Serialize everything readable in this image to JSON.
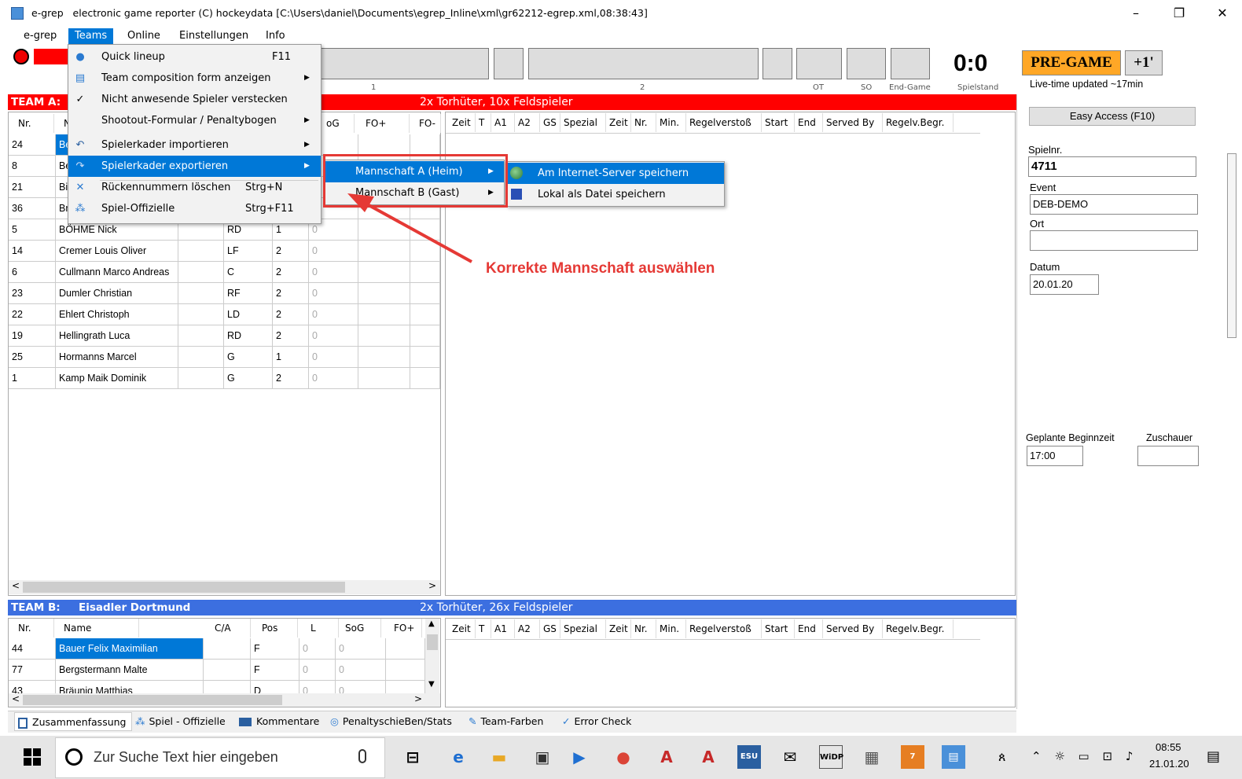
{
  "window": {
    "app_short": "e-grep",
    "title": "electronic game reporter (C) hockeydata [C:\\Users\\daniel\\Documents\\egrep_Inline\\xml\\gr62212-egrep.xml,08:38:43]",
    "minimize": "–",
    "maximize": "❐",
    "close": "✕"
  },
  "menubar": [
    "e-grep",
    "Teams",
    "Online",
    "Einstellungen",
    "Info"
  ],
  "scoreboard": {
    "score": "0:0",
    "labels": [
      "1",
      "2",
      "OT",
      "SO",
      "End-Game",
      "Spielstand"
    ],
    "status": "PRE-GAME",
    "plus": "+1'",
    "live_note": "Live-time updated ~17min"
  },
  "team_a": {
    "label": "TEAM A:",
    "summary": "2x Torhüter, 10x Feldspieler",
    "columns": [
      "Nr.",
      "N",
      "oG",
      "FO+",
      "FO-"
    ],
    "rows": [
      {
        "nr": "24",
        "name": "Be",
        "pos": "",
        "l": "",
        "sog": ""
      },
      {
        "nr": "8",
        "name": "Be",
        "pos": "",
        "l": "",
        "sog": ""
      },
      {
        "nr": "21",
        "name": "Bi",
        "pos": "",
        "l": "",
        "sog": ""
      },
      {
        "nr": "36",
        "name": "Br",
        "pos": "",
        "l": "",
        "sog": ""
      },
      {
        "nr": "5",
        "name": "BÖHME Nick",
        "pos": "RD",
        "l": "1",
        "sog": "0"
      },
      {
        "nr": "14",
        "name": "Cremer Louis Oliver",
        "pos": "LF",
        "l": "2",
        "sog": "0"
      },
      {
        "nr": "6",
        "name": "Cullmann Marco Andreas",
        "pos": "C",
        "l": "2",
        "sog": "0"
      },
      {
        "nr": "23",
        "name": "Dumler Christian",
        "pos": "RF",
        "l": "2",
        "sog": "0"
      },
      {
        "nr": "22",
        "name": "Ehlert Christoph",
        "pos": "LD",
        "l": "2",
        "sog": "0"
      },
      {
        "nr": "19",
        "name": "Hellingrath Luca",
        "pos": "RD",
        "l": "2",
        "sog": "0"
      },
      {
        "nr": "25",
        "name": "Hormanns Marcel",
        "pos": "G",
        "l": "1",
        "sog": "0"
      },
      {
        "nr": "1",
        "name": "Kamp Maik Dominik",
        "pos": "G",
        "l": "2",
        "sog": "0"
      }
    ]
  },
  "penalty_columns": [
    "Zeit",
    "T",
    "A1",
    "A2",
    "GS",
    "Spezial",
    "Zeit",
    "Nr.",
    "Min.",
    "Regelverstoß",
    "Start",
    "End",
    "Served By",
    "Regelv.Begr."
  ],
  "team_b": {
    "label": "TEAM B:",
    "name": "Eisadler Dortmund",
    "summary": "2x Torhüter, 26x Feldspieler",
    "columns": [
      "Nr.",
      "Name",
      "C/A",
      "Pos",
      "L",
      "SoG",
      "FO+"
    ],
    "rows": [
      {
        "nr": "44",
        "name": "Bauer Felix Maximilian",
        "pos": "F",
        "l": "0",
        "sog": "0"
      },
      {
        "nr": "77",
        "name": "Bergstermann Malte",
        "pos": "F",
        "l": "0",
        "sog": "0"
      },
      {
        "nr": "43",
        "name": "Bräunig Matthias",
        "pos": "D",
        "l": "0",
        "sog": "0"
      }
    ]
  },
  "right_panel": {
    "easy_access": "Easy Access (F10)",
    "spielnr_label": "Spielnr.",
    "spielnr": "4711",
    "event_label": "Event",
    "event": "DEB-DEMO",
    "ort_label": "Ort",
    "ort": "",
    "datum_label": "Datum",
    "datum": "20.01.20",
    "beginn_label": "Geplante Beginnzeit",
    "beginn": "17:00",
    "zuschauer_label": "Zuschauer",
    "zuschauer": ""
  },
  "teams_menu": [
    {
      "label": "Quick lineup",
      "shortcut": "F11",
      "icon": "person-icon"
    },
    {
      "label": "Team composition form anzeigen",
      "arrow": "▶",
      "icon": "form-icon"
    },
    {
      "label": "Nicht anwesende Spieler verstecken",
      "icon": "check-icon"
    },
    {
      "label": "Shootout-Formular / Penaltybogen",
      "arrow": "▶"
    },
    {
      "label": "Spielerkader importieren",
      "arrow": "▶",
      "icon": "import-icon"
    },
    {
      "label": "Spielerkader exportieren",
      "arrow": "▶",
      "icon": "export-icon"
    },
    {
      "label": "Rückennummern löschen",
      "shortcut": "Strg+N",
      "icon": "x-icon"
    },
    {
      "label": "Spiel-Offizielle",
      "shortcut": "Strg+F11",
      "icon": "people-icon"
    }
  ],
  "submenu_export": [
    "Mannschaft A (Heim)",
    "Mannschaft B (Gast)"
  ],
  "submenu_save": [
    "Am Internet-Server speichern",
    "Lokal als Datei speichern"
  ],
  "annotation": "Korrekte Mannschaft auswählen",
  "bottom_tabs": [
    "Zusammenfassung",
    "Spiel - Offizielle",
    "Kommentare",
    "PenaltyschieBen/Stats",
    "Team-Farben",
    "Error Check"
  ],
  "taskbar": {
    "search_placeholder": "Zur Suche Text hier eingeben",
    "time": "08:55",
    "date": "21.01.20"
  },
  "colors": {
    "red": "#ff0000",
    "blue": "#3c6fe0",
    "highlight": "#0078d7",
    "orange": "#ffa726",
    "annotation": "#e53935"
  }
}
